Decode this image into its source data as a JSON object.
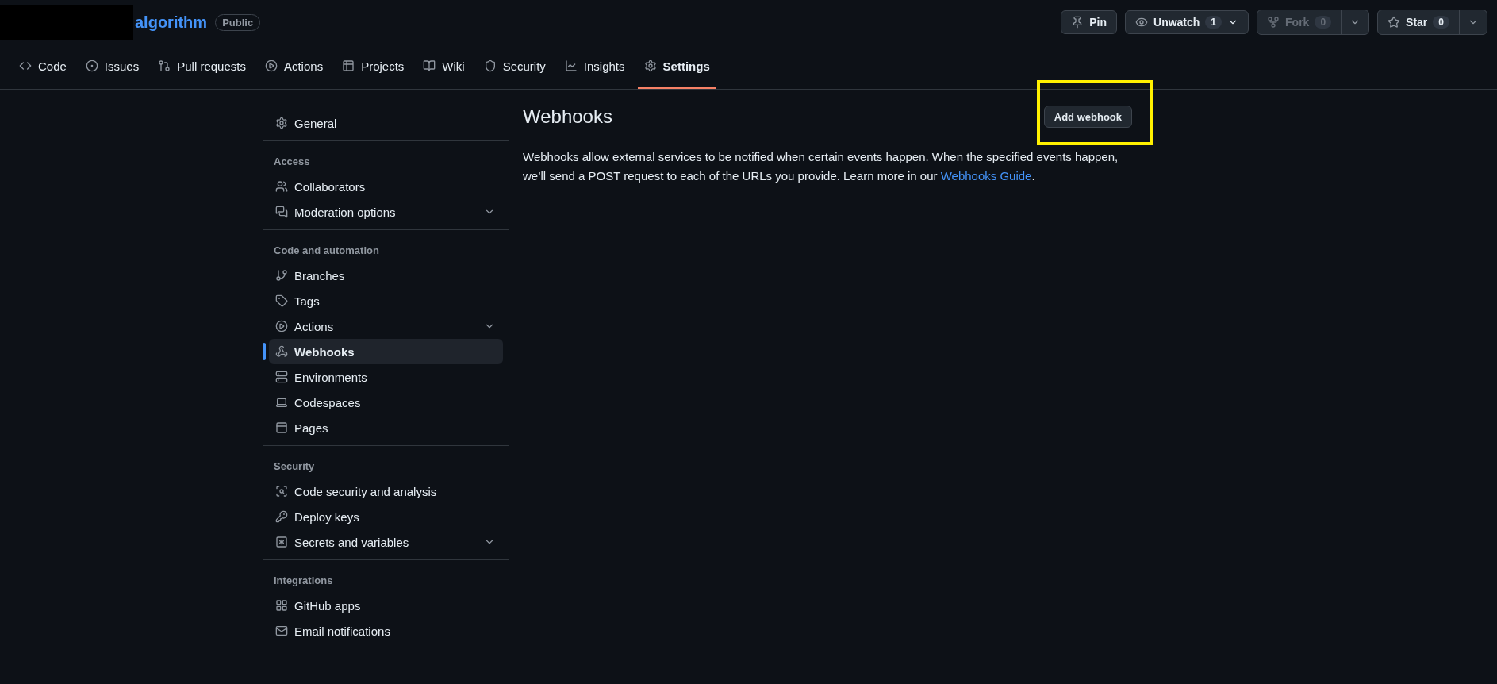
{
  "repo": {
    "name": "algorithm",
    "visibility": "Public"
  },
  "header_actions": [
    {
      "kind": "button",
      "label": "Pin",
      "disabled": false
    },
    {
      "kind": "counter",
      "label": "Unwatch",
      "count": "1",
      "disabled": false
    },
    {
      "kind": "split",
      "label": "Fork",
      "count": "0",
      "disabled": true
    },
    {
      "kind": "split",
      "label": "Star",
      "count": "0",
      "disabled": false
    }
  ],
  "tabs": [
    {
      "label": "Code",
      "selected": false
    },
    {
      "label": "Issues",
      "selected": false
    },
    {
      "label": "Pull requests",
      "selected": false
    },
    {
      "label": "Actions",
      "selected": false
    },
    {
      "label": "Projects",
      "selected": false
    },
    {
      "label": "Wiki",
      "selected": false
    },
    {
      "label": "Security",
      "selected": false
    },
    {
      "label": "Insights",
      "selected": false
    },
    {
      "label": "Settings",
      "selected": true
    }
  ],
  "sidebar": {
    "sections": [
      {
        "items": [
          {
            "label": "General",
            "expandable": false,
            "selected": false
          }
        ]
      },
      {
        "heading": "Access",
        "items": [
          {
            "label": "Collaborators",
            "expandable": false,
            "selected": false
          },
          {
            "label": "Moderation options",
            "expandable": true,
            "selected": false
          }
        ]
      },
      {
        "heading": "Code and automation",
        "items": [
          {
            "label": "Branches",
            "expandable": false,
            "selected": false
          },
          {
            "label": "Tags",
            "expandable": false,
            "selected": false
          },
          {
            "label": "Actions",
            "expandable": true,
            "selected": false
          },
          {
            "label": "Webhooks",
            "expandable": false,
            "selected": true
          },
          {
            "label": "Environments",
            "expandable": false,
            "selected": false
          },
          {
            "label": "Codespaces",
            "expandable": false,
            "selected": false
          },
          {
            "label": "Pages",
            "expandable": false,
            "selected": false
          }
        ]
      },
      {
        "heading": "Security",
        "items": [
          {
            "label": "Code security and analysis",
            "expandable": false,
            "selected": false
          },
          {
            "label": "Deploy keys",
            "expandable": false,
            "selected": false
          },
          {
            "label": "Secrets and variables",
            "expandable": true,
            "selected": false
          }
        ]
      },
      {
        "heading": "Integrations",
        "items": [
          {
            "label": "GitHub apps",
            "expandable": false,
            "selected": false
          },
          {
            "label": "Email notifications",
            "expandable": false,
            "selected": false
          }
        ]
      }
    ]
  },
  "main": {
    "title": "Webhooks",
    "button": "Add webhook",
    "description": {
      "text": "Webhooks allow external services to be notified when certain events happen. When the specified events happen, we’ll send a POST request to each of the URLs you provide. Learn more in our ",
      "link": "Webhooks Guide",
      "after": "."
    }
  }
}
